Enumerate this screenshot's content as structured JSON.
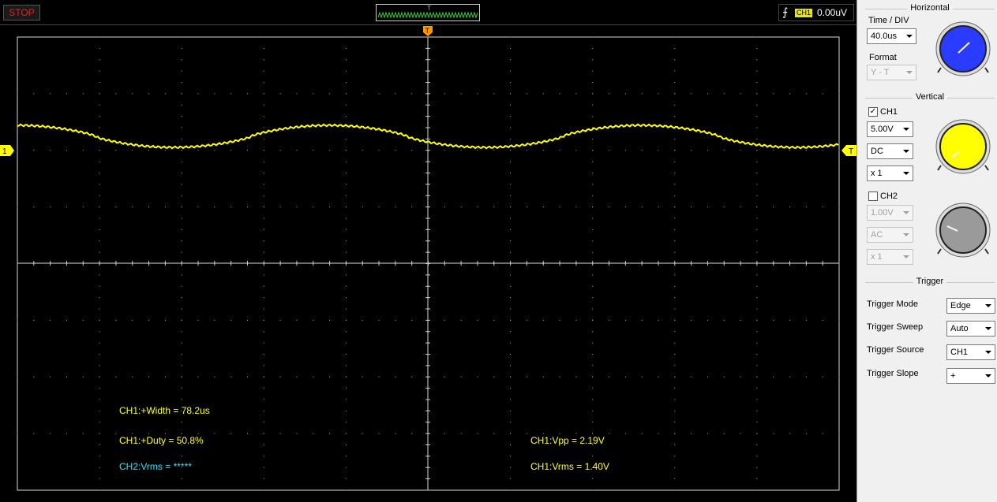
{
  "topbar": {
    "run_state": "STOP",
    "mini_wave_marker": "T",
    "trigger_channel": "CH1",
    "trigger_level": "0.00uV",
    "trigger_edge_icon": "rising-edge-icon"
  },
  "screen": {
    "trigger_pos_marker": "T",
    "ch1_marker": "1",
    "trigger_level_marker": "T",
    "measurements": {
      "ch1_width": "CH1:+Width = 78.2us",
      "ch1_duty": "CH1:+Duty = 50.8%",
      "ch2_vrms": "CH2:Vrms = *****",
      "ch1_vpp": "CH1:Vpp = 2.19V",
      "ch1_vrms": "CH1:Vrms = 1.40V"
    },
    "colors": {
      "ch1": "#ffff00",
      "ch2": "#33e0ff",
      "grid": "#b0b0b0",
      "marker": "#ff9900"
    }
  },
  "panel": {
    "horizontal": {
      "title": "Horizontal",
      "time_div_label": "Time / DIV",
      "time_div_value": "40.0us",
      "format_label": "Format",
      "format_value": "Y - T",
      "knob_color": "#2a3cff"
    },
    "vertical": {
      "title": "Vertical",
      "ch1_label": "CH1",
      "ch1_enabled": true,
      "ch1_volts": "5.00V",
      "ch1_coupling": "DC",
      "ch1_probe": "x 1",
      "ch1_knob_color": "#ffff00",
      "ch2_label": "CH2",
      "ch2_enabled": false,
      "ch2_volts": "1.00V",
      "ch2_coupling": "AC",
      "ch2_probe": "x 1",
      "ch2_knob_color": "#9a9a9a"
    },
    "trigger": {
      "title": "Trigger",
      "mode_label": "Trigger Mode",
      "mode_value": "Edge",
      "sweep_label": "Trigger Sweep",
      "sweep_value": "Auto",
      "source_label": "Trigger Source",
      "source_value": "CH1",
      "slope_label": "Trigger Slope",
      "slope_value": "+"
    }
  }
}
